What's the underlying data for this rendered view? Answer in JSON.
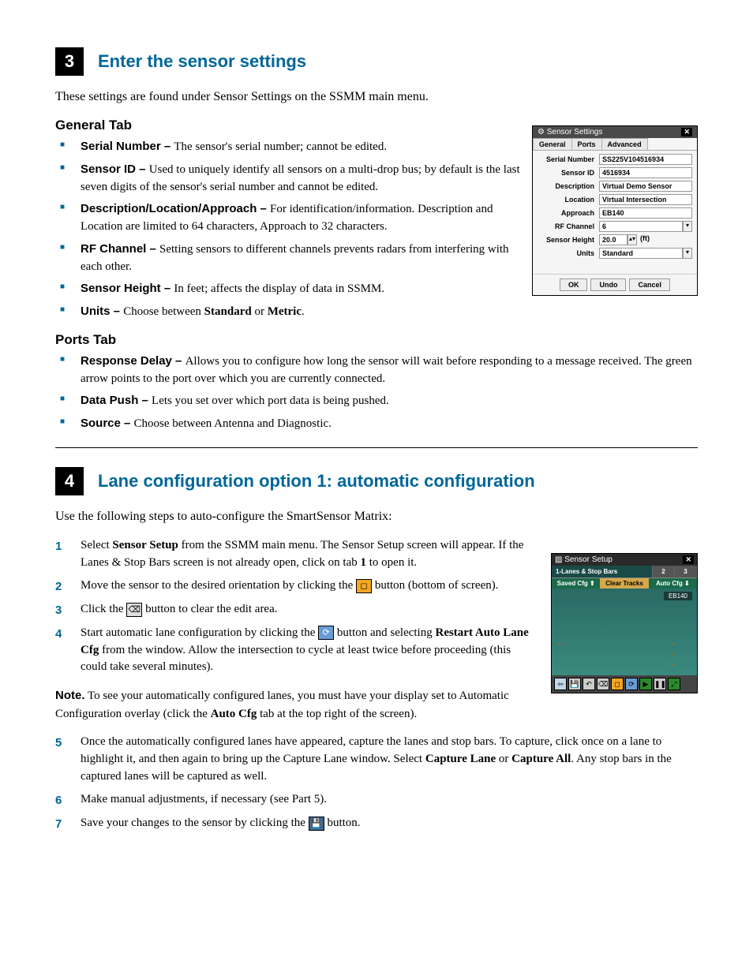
{
  "section3": {
    "number": "3",
    "title": "Enter the sensor settings",
    "intro": "These settings are found under Sensor Settings on the SSMM main menu.",
    "general": {
      "heading": "General Tab",
      "items": [
        {
          "label": "Serial Number – ",
          "text": "The sensor's serial number; cannot be edited."
        },
        {
          "label": "Sensor ID – ",
          "text": "Used to uniquely identify all sensors on a multi-drop bus; by default is the last seven digits of the sensor's serial number and cannot be edited."
        },
        {
          "label": "Description/Location/Approach – ",
          "text": "For identification/information. Description and Location are limited to 64 characters, Approach to 32 characters."
        },
        {
          "label": "RF Channel – ",
          "text": "Setting sensors to different channels prevents radars from interfering with each other."
        },
        {
          "label": "Sensor Height – ",
          "text": "In feet; affects the display of data in SSMM."
        },
        {
          "label": "Units – ",
          "text": "Choose between ",
          "bold1": "Standard",
          "mid": " or ",
          "bold2": "Metric",
          "end": "."
        }
      ]
    },
    "ports": {
      "heading": "Ports Tab",
      "items": [
        {
          "label": "Response Delay – ",
          "text": "Allows you to configure how long the sensor will wait before responding to a message received. The green arrow points to the port over which you are currently connected."
        },
        {
          "label": "Data Push – ",
          "text": "Lets you set over which port data is being pushed."
        },
        {
          "label": "Source – ",
          "text": "Choose between Antenna and Diagnostic."
        }
      ]
    }
  },
  "dialog1": {
    "title": "Sensor Settings",
    "tabs": [
      "General",
      "Ports",
      "Advanced"
    ],
    "fields": {
      "serial_number_lbl": "Serial Number",
      "serial_number_val": "SS225V104516934",
      "sensor_id_lbl": "Sensor ID",
      "sensor_id_val": "4516934",
      "description_lbl": "Description",
      "description_val": "Virtual Demo Sensor",
      "location_lbl": "Location",
      "location_val": "Virtual Intersection",
      "approach_lbl": "Approach",
      "approach_val": "EB140",
      "rf_channel_lbl": "RF Channel",
      "rf_channel_val": "6",
      "sensor_height_lbl": "Sensor Height",
      "sensor_height_val": "20.0",
      "sensor_height_unit": "(ft)",
      "units_lbl": "Units",
      "units_val": "Standard"
    },
    "buttons": {
      "ok": "OK",
      "undo": "Undo",
      "cancel": "Cancel"
    }
  },
  "section4": {
    "number": "4",
    "title": "Lane configuration option 1: automatic configuration",
    "intro": "Use the following steps to auto-configure the SmartSensor Matrix:",
    "steps": [
      {
        "n": "1",
        "parts": [
          "Select ",
          "Sensor Setup",
          " from the SSMM main menu. The Sensor Setup screen will appear. If the Lanes & Stop Bars screen is not already open, click on tab ",
          "1",
          " to open it."
        ]
      },
      {
        "n": "2",
        "pre": "Move the sensor to the desired orientation by clicking the ",
        "post_start": " button (bottom of screen)."
      },
      {
        "n": "3",
        "pre": "Click the ",
        "post": " button to clear the edit area."
      },
      {
        "n": "4",
        "pre": "Start automatic lane configuration by clicking the ",
        "mid": " button and selecting ",
        "bold": "Restart Auto Lane Cfg",
        "post": " from the window. Allow the intersection to cycle at least twice before proceeding (this could take several minutes)."
      }
    ],
    "note_label": "Note.",
    "note": " To see your automatically configured lanes, you must have your display set to Automatic Configuration overlay (click the ",
    "note_bold": "Auto Cfg",
    "note_end": " tab at the top right of the screen).",
    "steps2": [
      {
        "n": "5",
        "pre": "Once the automatically configured lanes have appeared, capture the lanes and stop bars. To capture, click once on a lane to highlight it, and then again to bring up the Capture Lane window. Select ",
        "b1": "Capture Lane",
        "mid": " or ",
        "b2": "Capture All",
        "post": ". Any stop bars in the captured lanes will be captured as well."
      },
      {
        "n": "6",
        "text": "Make manual adjustments, if necessary (see Part 5)."
      },
      {
        "n": "7",
        "pre": "Save your changes to the sensor by clicking the ",
        "post": " button."
      }
    ]
  },
  "dialog2": {
    "title": "Sensor Setup",
    "tabs": {
      "t1": "1-Lanes & Stop Bars",
      "t2": "2",
      "t3": "3"
    },
    "sub": {
      "saved": "Saved Cfg ⬆",
      "clear": "Clear Tracks",
      "auto": "Auto Cfg ⬇"
    },
    "label": "EB140"
  }
}
